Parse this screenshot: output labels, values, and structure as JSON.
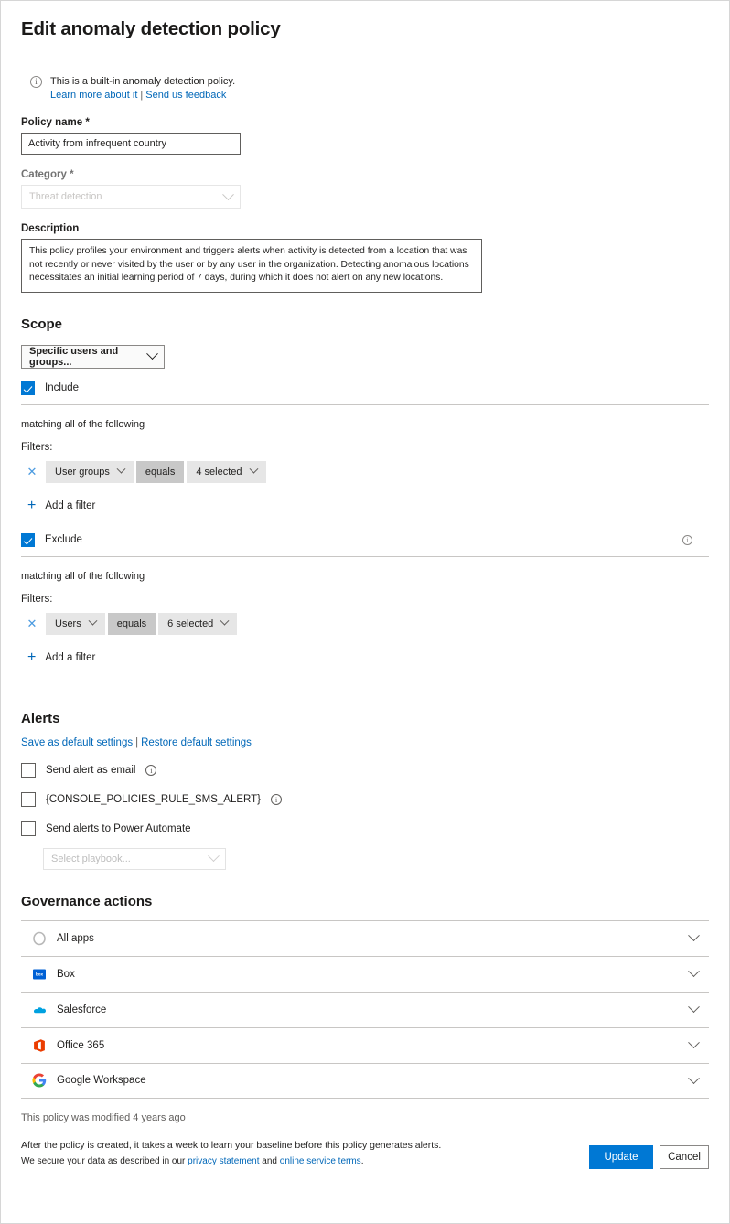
{
  "page": {
    "title": "Edit anomaly detection policy"
  },
  "info_banner": {
    "icon": "info-circle-icon",
    "text": "This is a built-in anomaly detection policy.",
    "link_learn": "Learn more about it",
    "separator": "|",
    "link_feedback": "Send us feedback"
  },
  "policy_name": {
    "label": "Policy name",
    "required_mark": "*",
    "value": "Activity from infrequent country",
    "placeholder": "Policy name"
  },
  "category": {
    "label": "Category",
    "required_mark": "*",
    "value": "Threat detection",
    "disabled": true
  },
  "description": {
    "label": "Description",
    "value": "This policy profiles your environment and triggers alerts when activity is detected from a location that was not recently or never visited by the user or by any user in the organization. Detecting anomalous locations necessitates an initial learning period of 7 days, during which it does not alert on any new locations."
  },
  "scope": {
    "heading": "Scope",
    "selector_value": "Specific users and groups...",
    "include": {
      "label": "Include",
      "checked": true,
      "matching_text": "matching all of the following",
      "filters_label": "Filters:",
      "filters": [
        {
          "field": "User groups",
          "operator": "equals",
          "value": "4 selected"
        }
      ],
      "add_filter_label": "Add a filter"
    },
    "exclude": {
      "label": "Exclude",
      "checked": true,
      "info_icon": "info-icon",
      "matching_text": "matching all of the following",
      "filters_label": "Filters:",
      "filters": [
        {
          "field": "Users",
          "operator": "equals",
          "value": "6 selected"
        }
      ],
      "add_filter_label": "Add a filter"
    }
  },
  "alerts": {
    "heading": "Alerts",
    "save_default_link": "Save as default settings",
    "separator": "|",
    "restore_default_link": "Restore default settings",
    "options": [
      {
        "label": "Send alert as email",
        "checked": false,
        "has_info": true
      },
      {
        "label": "{CONSOLE_POLICIES_RULE_SMS_ALERT}",
        "checked": false,
        "has_info": true
      },
      {
        "label": "Send alerts to Power Automate",
        "checked": false,
        "has_info": false
      }
    ],
    "playbook_placeholder": "Select playbook..."
  },
  "governance": {
    "heading": "Governance actions",
    "rows": [
      {
        "name": "All apps",
        "icon": "all-apps-icon"
      },
      {
        "name": "Box",
        "icon": "box-icon"
      },
      {
        "name": "Salesforce",
        "icon": "salesforce-icon"
      },
      {
        "name": "Office 365",
        "icon": "office365-icon"
      },
      {
        "name": "Google Workspace",
        "icon": "google-workspace-icon"
      }
    ]
  },
  "footer": {
    "modified_text": "This policy was modified 4 years ago",
    "note_line1": "After the policy is created, it takes a week to learn your baseline before this policy generates alerts.",
    "note_line2_prefix": "We secure your data as described in our ",
    "privacy_link": "privacy statement",
    "note_line2_mid": " and ",
    "terms_link": "online service terms",
    "note_line2_suffix": ".",
    "update_label": "Update",
    "cancel_label": "Cancel"
  },
  "colors": {
    "accent": "#0078d4",
    "link": "#0067b8",
    "pill": "#e6e6e6",
    "pill_dark": "#c8c8c8",
    "divider": "#c8c6c4"
  }
}
